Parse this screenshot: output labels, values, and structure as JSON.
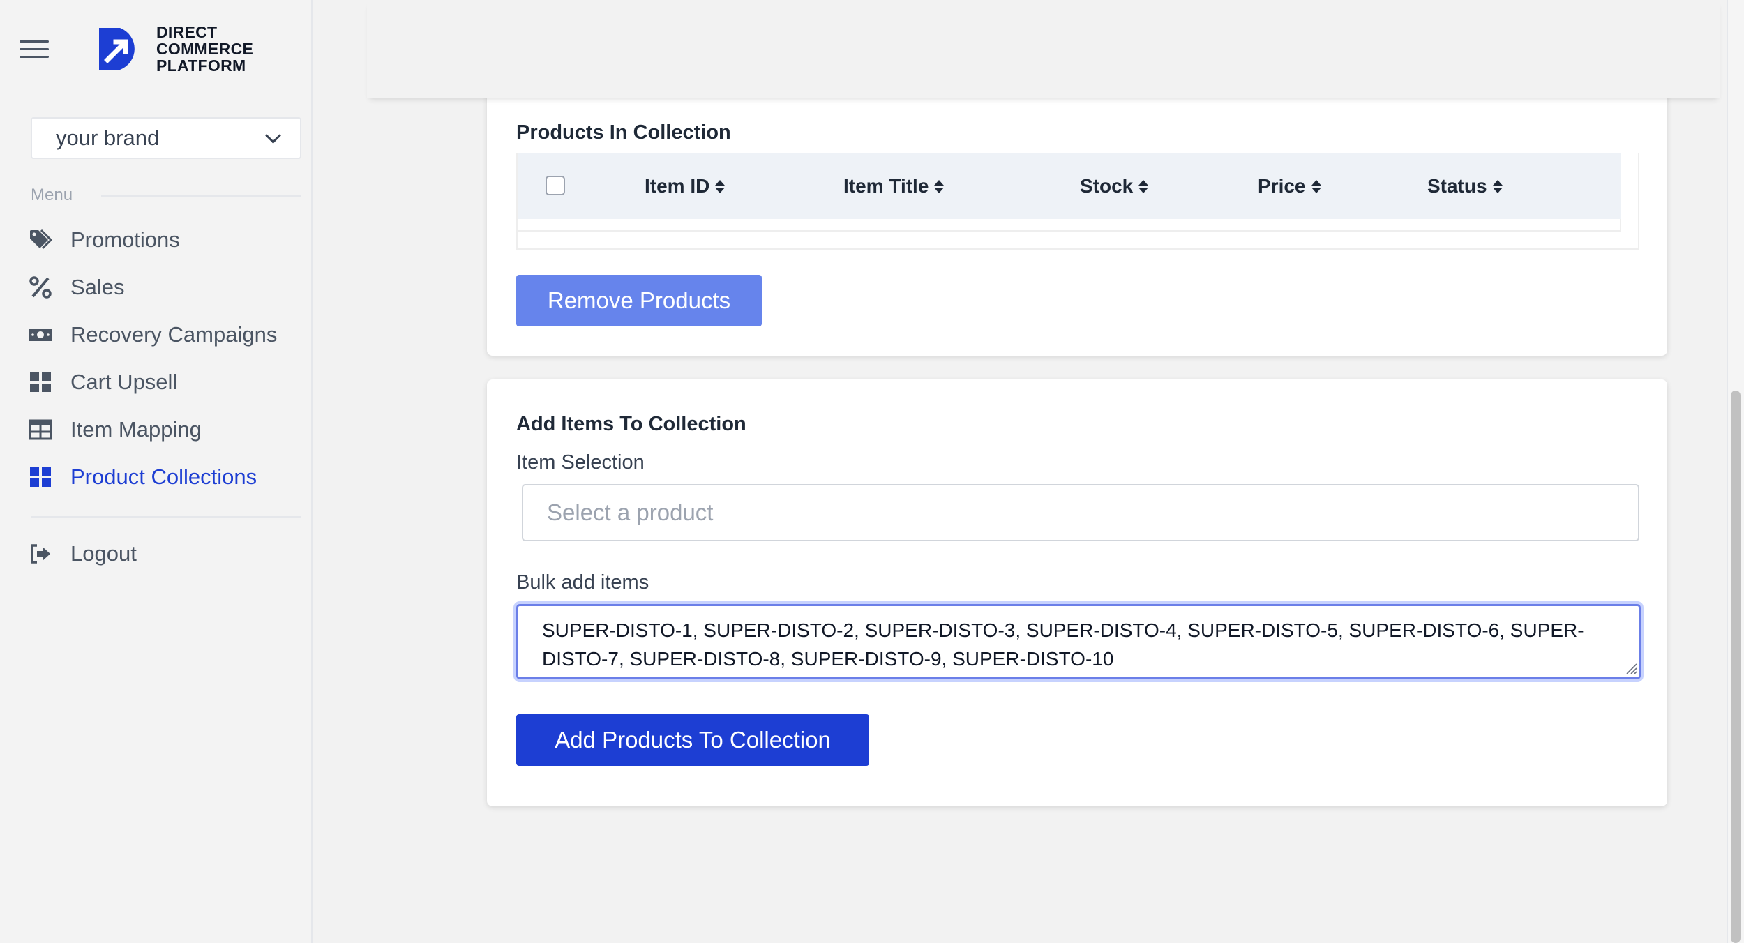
{
  "logo": {
    "text": "DIRECT\nCOMMERCE\nPLATFORM",
    "color": "#1d3ed3"
  },
  "brand_select": {
    "value": "your brand"
  },
  "menu": {
    "label": "Menu",
    "items": [
      {
        "label": "Promotions",
        "icon": "tags-icon"
      },
      {
        "label": "Sales",
        "icon": "percent-icon"
      },
      {
        "label": "Recovery Campaigns",
        "icon": "money-bill-icon"
      },
      {
        "label": "Cart Upsell",
        "icon": "grid-icon"
      },
      {
        "label": "Item Mapping",
        "icon": "table-icon"
      },
      {
        "label": "Product Collections",
        "icon": "grid-icon",
        "active": true
      }
    ],
    "logout": "Logout"
  },
  "products_card": {
    "title": "Products In Collection",
    "columns": [
      "Item ID",
      "Item Title",
      "Stock",
      "Price",
      "Status"
    ],
    "rows": [],
    "remove_button": "Remove Products"
  },
  "add_card": {
    "title": "Add Items To Collection",
    "item_selection_label": "Item Selection",
    "item_selection_placeholder": "Select a product",
    "bulk_label": "Bulk add items",
    "bulk_value": "SUPER-DISTO-1, SUPER-DISTO-2, SUPER-DISTO-3, SUPER-DISTO-4, SUPER-DISTO-5, SUPER-DISTO-6, SUPER-DISTO-7, SUPER-DISTO-8, SUPER-DISTO-9, SUPER-DISTO-10",
    "add_button": "Add Products To Collection"
  },
  "colors": {
    "accent": "#1d3ed3",
    "accent_light": "#6684ec",
    "table_header_bg": "#eef2f7"
  }
}
